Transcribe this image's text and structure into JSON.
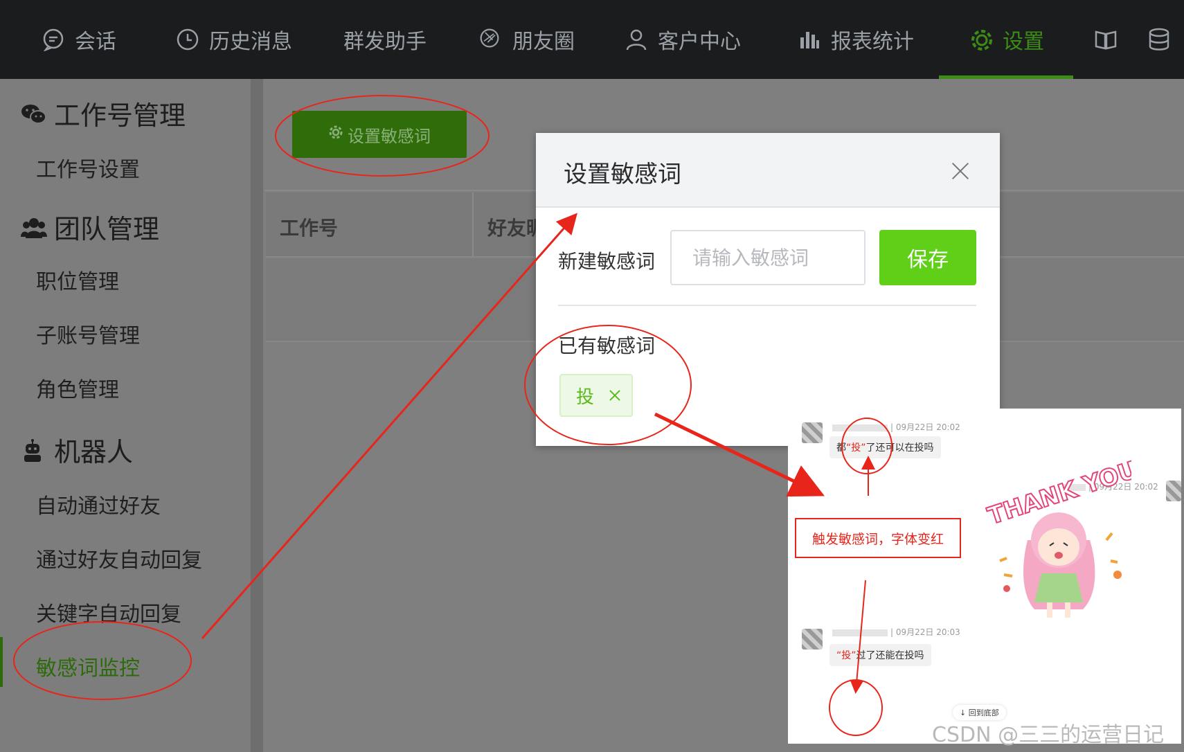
{
  "topnav": {
    "items": [
      {
        "label": "会话",
        "icon": "chat-bubble-icon"
      },
      {
        "label": "历史消息",
        "icon": "clock-icon"
      },
      {
        "label": "群发助手",
        "icon": ""
      },
      {
        "label": "朋友圈",
        "icon": "aperture-icon"
      },
      {
        "label": "客户中心",
        "icon": "user-icon"
      },
      {
        "label": "报表统计",
        "icon": "bar-chart-icon"
      },
      {
        "label": "设置",
        "icon": "gear-icon",
        "active": true
      }
    ],
    "extra_icons": [
      "book-icon",
      "database-icon"
    ],
    "active_color": "#3c8d16"
  },
  "sidebar": {
    "groups": [
      {
        "title": "工作号管理",
        "icon": "wechat-icon",
        "items": [
          "工作号设置"
        ]
      },
      {
        "title": "团队管理",
        "icon": "team-icon",
        "items": [
          "职位管理",
          "子账号管理",
          "角色管理"
        ]
      },
      {
        "title": "机器人",
        "icon": "robot-icon",
        "items": [
          "自动通过好友",
          "通过好友自动回复",
          "关键字自动回复",
          "敏感词监控"
        ]
      }
    ],
    "active_item": "敏感词监控"
  },
  "main": {
    "button_label": "设置敏感词",
    "table_headers": [
      "工作号",
      "好友昵"
    ]
  },
  "modal": {
    "title": "设置敏感词",
    "new_label": "新建敏感词",
    "input_placeholder": "请输入敏感词",
    "input_value": "",
    "save_label": "保存",
    "existing_label": "已有敏感词",
    "tags": [
      "投"
    ],
    "save_color": "#5fcf17"
  },
  "chat": {
    "messages": [
      {
        "time": "| 09月22日 20:02",
        "prefix": "都",
        "highlight": "“投”",
        "suffix": "了还可以在投吗"
      },
      {
        "time": "| 09月22日 20:02"
      },
      {
        "time": "| 09月22日 20:03",
        "prefix": "",
        "highlight": "“投”",
        "suffix": "过了还能在投吗"
      }
    ],
    "callout": "触发敏感词，字体变红",
    "sticker_text": "THANK YOU",
    "back_to_bottom": "回到底部",
    "highlight_color": "#e8251b"
  },
  "watermark": "CSDN @三三的运营日记"
}
